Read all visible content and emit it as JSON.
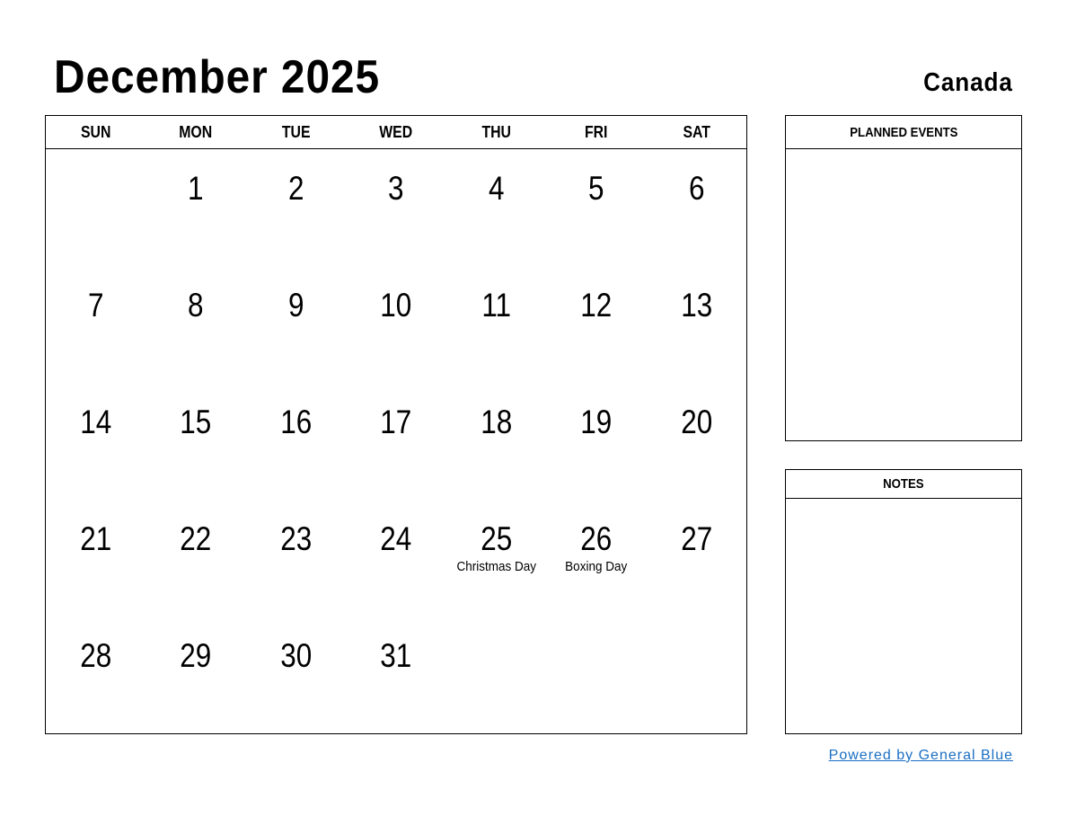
{
  "header": {
    "title": "December 2025",
    "country": "Canada"
  },
  "calendar": {
    "weekdays": [
      "SUN",
      "MON",
      "TUE",
      "WED",
      "THU",
      "FRI",
      "SAT"
    ],
    "weeks": [
      [
        {
          "day": ""
        },
        {
          "day": "1"
        },
        {
          "day": "2"
        },
        {
          "day": "3"
        },
        {
          "day": "4"
        },
        {
          "day": "5"
        },
        {
          "day": "6"
        }
      ],
      [
        {
          "day": "7"
        },
        {
          "day": "8"
        },
        {
          "day": "9"
        },
        {
          "day": "10"
        },
        {
          "day": "11"
        },
        {
          "day": "12"
        },
        {
          "day": "13"
        }
      ],
      [
        {
          "day": "14"
        },
        {
          "day": "15"
        },
        {
          "day": "16"
        },
        {
          "day": "17"
        },
        {
          "day": "18"
        },
        {
          "day": "19"
        },
        {
          "day": "20"
        }
      ],
      [
        {
          "day": "21"
        },
        {
          "day": "22"
        },
        {
          "day": "23"
        },
        {
          "day": "24"
        },
        {
          "day": "25",
          "holiday": "Christmas Day"
        },
        {
          "day": "26",
          "holiday": "Boxing Day"
        },
        {
          "day": "27"
        }
      ],
      [
        {
          "day": "28"
        },
        {
          "day": "29"
        },
        {
          "day": "30"
        },
        {
          "day": "31"
        },
        {
          "day": ""
        },
        {
          "day": ""
        },
        {
          "day": ""
        }
      ]
    ]
  },
  "panels": {
    "planned_events": "PLANNED EVENTS",
    "notes": "NOTES"
  },
  "footer": {
    "link_text": "Powered by General Blue",
    "link_color": "#1a6fc4"
  }
}
